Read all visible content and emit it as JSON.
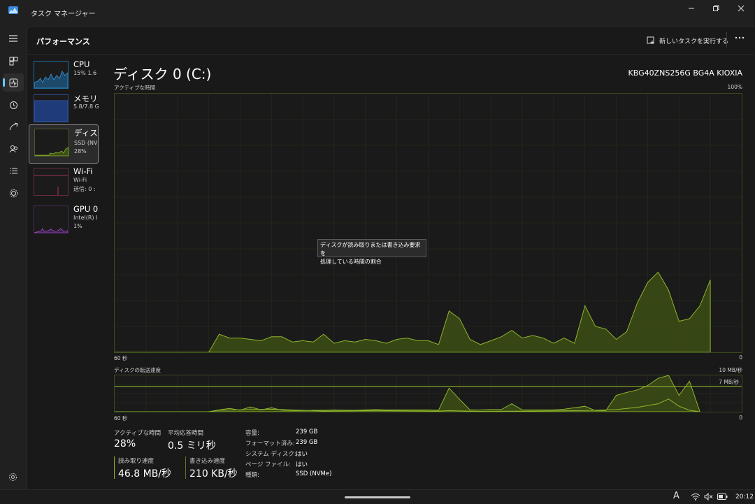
{
  "window": {
    "title": "タスク マネージャー"
  },
  "header": {
    "page_title": "パフォーマンス",
    "run_task_label": "新しいタスクを実行する"
  },
  "nav": {
    "items": [
      "menu-icon",
      "processes-icon",
      "performance-icon",
      "app-history-icon",
      "startup-icon",
      "users-icon",
      "details-icon",
      "services-icon"
    ],
    "active": "performance-icon",
    "settings": "gear-icon"
  },
  "devices": [
    {
      "name": "CPU",
      "sub1": "15% 1.6",
      "sub2": ""
    },
    {
      "name": "メモリ",
      "sub1": "5.8/7.8 G",
      "sub2": ""
    },
    {
      "name": "ディスク",
      "sub1": "SSD (NV",
      "sub2": "28%"
    },
    {
      "name": "Wi-Fi",
      "sub1": "Wi-Fi",
      "sub2": "送信: 0 :"
    },
    {
      "name": "GPU 0",
      "sub1": "Intel(R) I",
      "sub2": "1%"
    }
  ],
  "disk": {
    "title": "ディスク 0 (C:)",
    "model": "KBG40ZNS256G BG4A KIOXIA",
    "active_chart": {
      "label": "アクティブな時間",
      "max": "100%",
      "x_left": "60 秒",
      "x_right": "0"
    },
    "transfer_chart": {
      "label": "ディスクの転送速度",
      "max": "10 MB/秒",
      "ref": "7 MB/秒",
      "x_left": "60 秒",
      "x_right": "0"
    },
    "tooltip": {
      "line1": "ディスクが読み取りまたは書き込み要求を",
      "line2": "処理している時間の割合"
    },
    "stats": {
      "active_label": "アクティブな時間",
      "active_value": "28%",
      "response_label": "平均応答時間",
      "response_value": "0.5 ミリ秒",
      "read_label": "読み取り速度",
      "read_value": "46.8 MB/秒",
      "write_label": "書き込み速度",
      "write_value": "210 KB/秒"
    },
    "props": [
      {
        "k": "容量:",
        "v": "239 GB"
      },
      {
        "k": "フォーマット済み:",
        "v": "239 GB"
      },
      {
        "k": "システム ディスク:",
        "v": "はい"
      },
      {
        "k": "ページ ファイル:",
        "v": "はい"
      },
      {
        "k": "種類:",
        "v": "SSD (NVMe)"
      }
    ]
  },
  "taskbar": {
    "time": "20:12",
    "ime": "A"
  },
  "colors": {
    "disk": "#8fb52c",
    "cpu": "#3a96dd",
    "memory": "#3a5fb0",
    "wifi": "#d03a7a",
    "gpu": "#a74ed0",
    "accent": "#60cdff"
  },
  "chart_data": [
    {
      "type": "area",
      "label": "アクティブな時間",
      "ylim": [
        0,
        100
      ],
      "x_range": [
        60,
        0
      ],
      "points": [
        [
          60,
          0
        ],
        [
          51,
          0
        ],
        [
          50,
          7
        ],
        [
          49,
          5.5
        ],
        [
          48,
          5.5
        ],
        [
          47,
          5
        ],
        [
          46,
          4.5
        ],
        [
          45,
          6
        ],
        [
          44,
          6
        ],
        [
          43,
          4
        ],
        [
          42,
          4.5
        ],
        [
          41,
          4
        ],
        [
          40,
          7
        ],
        [
          39,
          3.5
        ],
        [
          38,
          4.5
        ],
        [
          37,
          4
        ],
        [
          36,
          5
        ],
        [
          35,
          4.5
        ],
        [
          34,
          3.5
        ],
        [
          33,
          5
        ],
        [
          32,
          5.5
        ],
        [
          31,
          4.5
        ],
        [
          30,
          4.5
        ],
        [
          29,
          3
        ],
        [
          28,
          16
        ],
        [
          27,
          13
        ],
        [
          26,
          5
        ],
        [
          25,
          3
        ],
        [
          24,
          4.5
        ],
        [
          23,
          6
        ],
        [
          22,
          8.5
        ],
        [
          21,
          5.5
        ],
        [
          20,
          6.5
        ],
        [
          19,
          5.5
        ],
        [
          18,
          3.5
        ],
        [
          17,
          5.5
        ],
        [
          16,
          3.5
        ],
        [
          15,
          18
        ],
        [
          14,
          10
        ],
        [
          13,
          9
        ],
        [
          12,
          5
        ],
        [
          11,
          8
        ],
        [
          10,
          19
        ],
        [
          9,
          27
        ],
        [
          8,
          31
        ],
        [
          7,
          24
        ],
        [
          6,
          12
        ],
        [
          5,
          13
        ],
        [
          4,
          18
        ],
        [
          3,
          28
        ]
      ]
    },
    {
      "type": "area",
      "label": "ディスクの転送速度",
      "ylim": [
        0,
        10
      ],
      "reference_line": 7,
      "x_range": [
        60,
        0
      ],
      "series": [
        {
          "kind": "read",
          "points": [
            [
              60,
              0
            ],
            [
              51,
              0
            ],
            [
              50,
              0.5
            ],
            [
              49,
              0.9
            ],
            [
              48,
              0.4
            ],
            [
              47,
              1.3
            ],
            [
              46,
              0.5
            ],
            [
              45,
              1.1
            ],
            [
              44,
              0.4
            ],
            [
              43,
              0.3
            ],
            [
              42,
              0.3
            ],
            [
              41,
              0.4
            ],
            [
              40,
              0.4
            ],
            [
              39,
              0.5
            ],
            [
              38,
              0.4
            ],
            [
              37,
              0.4
            ],
            [
              36,
              0.5
            ],
            [
              35,
              0.6
            ],
            [
              34,
              0.5
            ],
            [
              33,
              0.5
            ],
            [
              32,
              0.5
            ],
            [
              31,
              0.5
            ],
            [
              30,
              0.5
            ],
            [
              29,
              0.4
            ],
            [
              28,
              6.5
            ],
            [
              27,
              3.4
            ],
            [
              26,
              0.5
            ],
            [
              25,
              0.5
            ],
            [
              24,
              0.6
            ],
            [
              23,
              0.6
            ],
            [
              22,
              2.2
            ],
            [
              21,
              0.5
            ],
            [
              20,
              0.5
            ],
            [
              19,
              0.5
            ],
            [
              18,
              0.5
            ],
            [
              17,
              0.7
            ],
            [
              16,
              1.1
            ],
            [
              15,
              1.5
            ],
            [
              14,
              0.3
            ],
            [
              13,
              0.3
            ],
            [
              12,
              4.5
            ],
            [
              11,
              5.3
            ],
            [
              10,
              6
            ],
            [
              9,
              7.2
            ],
            [
              8,
              9.2
            ],
            [
              7,
              10
            ],
            [
              6,
              4.5
            ],
            [
              5,
              8.4
            ],
            [
              4,
              0
            ]
          ]
        },
        {
          "kind": "write",
          "points": [
            [
              60,
              0
            ],
            [
              51,
              0
            ],
            [
              50,
              0.4
            ],
            [
              45,
              0.7
            ],
            [
              40,
              0.2
            ],
            [
              35,
              0.3
            ],
            [
              29,
              0.2
            ],
            [
              28,
              0.3
            ],
            [
              25,
              0.1
            ],
            [
              20,
              0.2
            ],
            [
              15,
              0.3
            ],
            [
              12,
              0.6
            ],
            [
              10,
              1.2
            ],
            [
              8,
              2.2
            ],
            [
              7,
              3.5
            ],
            [
              6,
              1.5
            ],
            [
              5,
              0.4
            ],
            [
              4,
              0
            ]
          ]
        }
      ]
    }
  ]
}
